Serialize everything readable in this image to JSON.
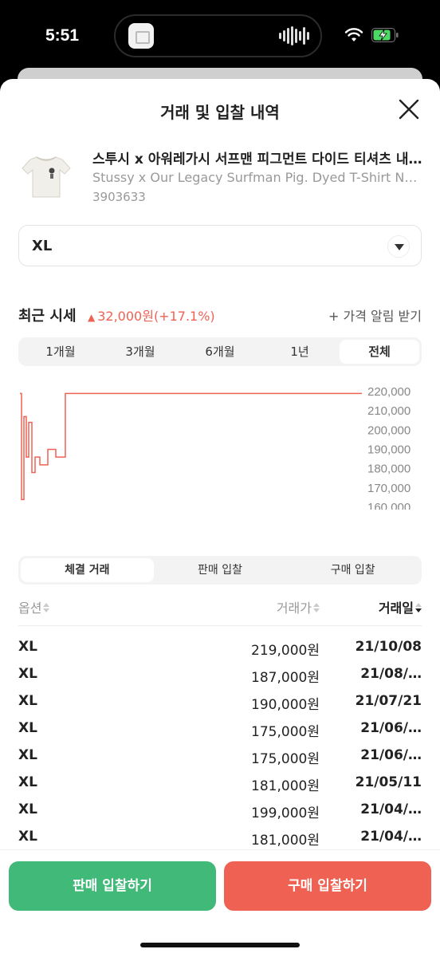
{
  "status_bar": {
    "time": "5:51"
  },
  "header": {
    "title": "거래 및 입찰 내역"
  },
  "product": {
    "name_ko": "스투시 x 아워레가시 서프맨 피그먼트 다이드 티셔츠 내추럴",
    "name_en": "Stussy x Our Legacy Surfman Pig. Dyed T-Shirt Natural",
    "code": "3903633"
  },
  "size_select": {
    "value": "XL"
  },
  "price_summary": {
    "label": "최근 시세",
    "change": "32,000원(+17.1%)",
    "change_color": "#ef6253",
    "alert_label": "+ 가격 알림 받기"
  },
  "period_tabs": [
    {
      "label": "1개월",
      "active": false
    },
    {
      "label": "3개월",
      "active": false
    },
    {
      "label": "6개월",
      "active": false
    },
    {
      "label": "1년",
      "active": false
    },
    {
      "label": "전체",
      "active": true
    }
  ],
  "chart_data": {
    "type": "line",
    "series": [
      {
        "values": [
          219000,
          164000,
          207000,
          186000,
          204000,
          178000,
          186000,
          182000,
          182000,
          182000,
          190000,
          190000,
          186000,
          186000,
          186000,
          219000,
          219000,
          219000
        ]
      }
    ],
    "y_ticks": [
      "220,000",
      "210,000",
      "200,000",
      "190,000",
      "180,000",
      "170,000",
      "160,000"
    ],
    "ylim": [
      160000,
      220000
    ],
    "line_color": "#ef6253"
  },
  "trade_tabs": [
    {
      "label": "체결 거래",
      "active": true
    },
    {
      "label": "판매 입찰",
      "active": false
    },
    {
      "label": "구매 입찰",
      "active": false
    }
  ],
  "table": {
    "headers": {
      "option": "옵션",
      "price": "거래가",
      "date": "거래일"
    },
    "rows": [
      {
        "option": "XL",
        "price": "219,000원",
        "date": "21/10/08"
      },
      {
        "option": "XL",
        "price": "187,000원",
        "date": "21/08/…"
      },
      {
        "option": "XL",
        "price": "190,000원",
        "date": "21/07/21"
      },
      {
        "option": "XL",
        "price": "175,000원",
        "date": "21/06/…"
      },
      {
        "option": "XL",
        "price": "175,000원",
        "date": "21/06/…"
      },
      {
        "option": "XL",
        "price": "181,000원",
        "date": "21/05/11"
      },
      {
        "option": "XL",
        "price": "199,000원",
        "date": "21/04/…"
      },
      {
        "option": "XL",
        "price": "181,000원",
        "date": "21/04/…"
      }
    ]
  },
  "actions": {
    "sell_label": "판매 입찰하기",
    "buy_label": "구매 입찰하기",
    "sell_color": "#41b979",
    "buy_color": "#ef6253"
  }
}
